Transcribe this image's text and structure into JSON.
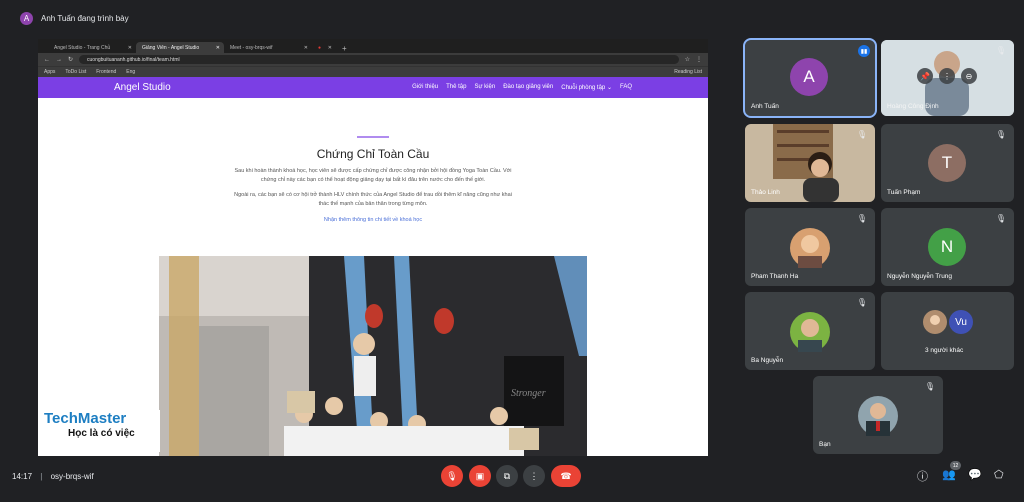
{
  "top": {
    "presenter_initial": "A",
    "presenter_text": "Anh Tuấn đang trình bày"
  },
  "browser": {
    "tabs": [
      {
        "label": "Angel Studio - Trang Chủ",
        "active": false
      },
      {
        "label": "Giảng Viên - Angel Studio",
        "active": true
      },
      {
        "label": "Meet - osy-brqs-wif",
        "active": false
      },
      {
        "label": "",
        "active": false
      }
    ],
    "url": "cuongbuituananh.github.io/final/team.html",
    "bookmarks": [
      "Apps",
      "ToDo List",
      "Frontend",
      "Eng"
    ],
    "reading_list": "Reading List"
  },
  "site": {
    "brand": "Angel Studio",
    "nav": [
      "Giới thiệu",
      "Thẻ tập",
      "Sự kiện",
      "Đào tạo giảng viên",
      "Chuỗi phòng tập",
      "FAQ"
    ],
    "heading": "Chứng Chỉ Toàn Cầu",
    "para1": "Sau khi hoàn thành khoá học, học viên sẽ được cấp chứng chỉ được công nhận bởi hội đồng Yoga Toàn Cầu. Với chứng chỉ này các bạn có thể hoạt động giảng dạy tại bất kì đâu trên nước cho đến thế giới.",
    "para2": "Ngoài ra, các bạn sẽ có cơ hội trở thành HLV chính thức của Angel Studio để trau dồi thêm kĩ năng cũng như khai thác thế mạnh của bản thân trong từng môn.",
    "link": "Nhận thêm thông tin chi tiết về khoá học",
    "photo_text": "Stronger"
  },
  "watermark": {
    "title": "TechMaster",
    "subtitle": "Học là có việc"
  },
  "participants": [
    {
      "name": "Anh Tuấn",
      "initial": "A",
      "color": "#8e44ad"
    },
    {
      "name": "Hoàng Công Định"
    },
    {
      "name": "Thảo Linh"
    },
    {
      "name": "Tuấn Phạm",
      "initial": "T",
      "color": "#8d6e63"
    },
    {
      "name": "Pham Thanh Ha"
    },
    {
      "name": "Nguyễn Nguyễn Trung",
      "initial": "N",
      "color": "#43a047"
    },
    {
      "name": "Ba Nguyễn"
    },
    {
      "name": "3 người khác",
      "initial": "Vu",
      "color": "#3f51b5"
    },
    {
      "name": "Bạn"
    }
  ],
  "bottom": {
    "time": "14:17",
    "separator": "|",
    "meeting_code": "osy-brqs-wif",
    "people_count": "12"
  },
  "colors": {
    "accent": "#7b3fe4",
    "end_call": "#ea4335",
    "tile_bg": "#3c4043",
    "page_bg": "#202124"
  }
}
